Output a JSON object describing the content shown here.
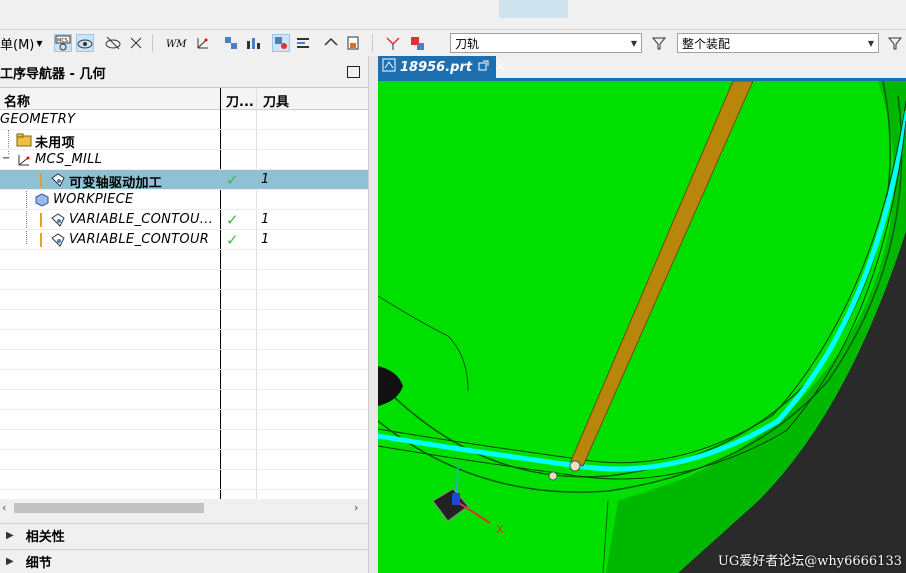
{
  "toolbar": {
    "menu_label": "单(M)",
    "combo_toolpath": "刀轨",
    "combo_assembly": "整个装配"
  },
  "navigator": {
    "title": "工序导航器 - 几何",
    "columns": {
      "name": "名称",
      "path": "刀...",
      "tool": "刀具"
    },
    "rows": [
      {
        "name": "GEOMETRY",
        "check": "",
        "tool": ""
      },
      {
        "name": "未用项",
        "check": "",
        "tool": ""
      },
      {
        "name": "MCS_MILL",
        "check": "",
        "tool": ""
      },
      {
        "name": "可变轴驱动加工",
        "check": "✓",
        "tool": "1"
      },
      {
        "name": "WORKPIECE",
        "check": "",
        "tool": ""
      },
      {
        "name": "VARIABLE_CONTOU...",
        "check": "✓",
        "tool": "1"
      },
      {
        "name": "VARIABLE_CONTOUR",
        "check": "✓",
        "tool": "1"
      }
    ]
  },
  "sections": {
    "relevance": "相关性",
    "details": "细节"
  },
  "viewport": {
    "tab_label": "18956.prt",
    "axis_x": "X",
    "colors": {
      "part_green": "#00e000",
      "dark_green": "#00a800",
      "toolpath_cyan": "#00ffff",
      "tool_orange": "#b8860b",
      "background_dark": "#2a2a2a"
    }
  },
  "watermark": "UG爱好者论坛@why6666133"
}
